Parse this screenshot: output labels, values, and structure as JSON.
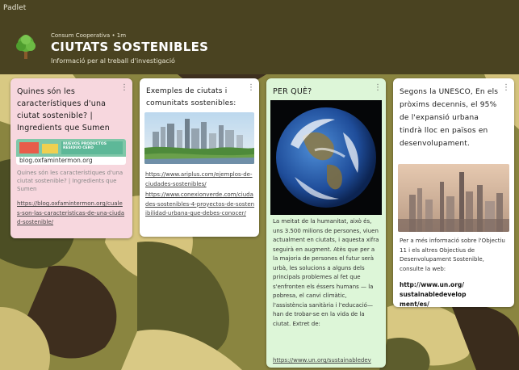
{
  "app": {
    "brand": "Padlet"
  },
  "header": {
    "meta": "Consum Cooperativa • 1m",
    "title": "CIUTATS SOSTENIBLES",
    "subtitle": "Informació per al treball d'investigació"
  },
  "posts": [
    {
      "title": "Quines són les característiques d'una ciutat sostenible? | Ingredients que Sumen",
      "attachment": {
        "banner_text": "NUEVOS PRODUCTOS RESIDUO CERO",
        "domain": "blog.oxfamintermon.org"
      },
      "preview": "Quines són les característiques d'una ciutat sostenible? | Ingredients que Sumen",
      "link": "https://blog.oxfamintermon.org/cuales-son-las-caracteristicas-de-una-ciudad-sostenible/"
    },
    {
      "title": "Exemples de ciutats i comunitats sostenibles:",
      "links": [
        "https://www.ariplus.com/ejemplos-de-ciudades-sostenibles/",
        "https://www.conexionverde.com/ciudades-sostenibles-4-proyectos-de-sostenibilidad-urbana-que-debes-conocer/"
      ]
    },
    {
      "title": "PER QUÈ?",
      "body": "La meitat de la humanitat, això és, uns 3.500 milions de persones, viuen actualment en ciutats, i aquesta xifra seguirà en augment. Atès que per a la majoria de persones el futur serà urbà, les solucions a alguns dels principals problemes al fet que s'enfronten els éssers humans — la pobresa, el canvi climàtic, l'assistència sanitària i l'educació— han de trobar-se en la vida de la ciutat. Extret de:",
      "link": "https://www.un.org/sustainabledev"
    },
    {
      "title": "Segons la UNESCO, En els pròxims decennis, el 95% de l'expansió urbana tindrà lloc en països en desenvolupament.",
      "body": "Per a més informació sobre l'Objectiu 11 i els altres Objectius de Desenvolupament Sostenible, consulte la web:",
      "link": "http://www.un.org/sustainabledevelopment/es/"
    }
  ]
}
